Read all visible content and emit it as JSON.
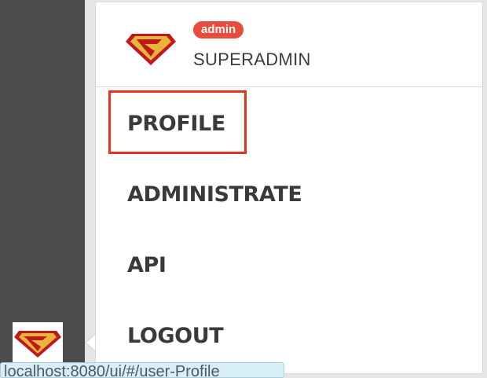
{
  "user": {
    "role_badge": "admin",
    "name": "SUPERADMIN",
    "avatar_icon": "superman-logo-icon"
  },
  "menu": {
    "items": [
      {
        "label": "PROFILE",
        "highlighted": true
      },
      {
        "label": "ADMINISTRATE",
        "highlighted": false
      },
      {
        "label": "API",
        "highlighted": false
      },
      {
        "label": "LOGOUT",
        "highlighted": false
      }
    ]
  },
  "status_bar": {
    "url": "localhost:8080/ui/#/user-Profile"
  },
  "colors": {
    "badge": "#e74c3c",
    "highlight": "#e8321f",
    "rail": "#4b4b4e"
  }
}
